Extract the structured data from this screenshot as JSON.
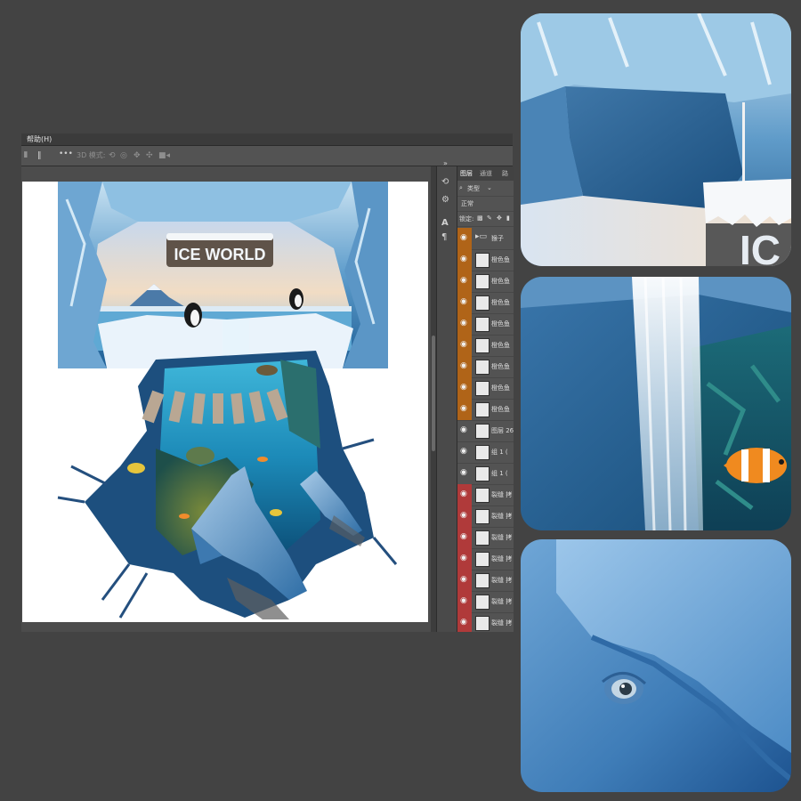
{
  "menubar": {
    "help_label": "帮助(H)"
  },
  "options_bar": {
    "mode_label": "3D 模式:",
    "more_label": "•••"
  },
  "layers_panel": {
    "tabs": [
      "图层",
      "通道",
      "路"
    ],
    "filter_label": "类型",
    "blend_mode": "正常",
    "lock_label": "锁定:",
    "layers": [
      {
        "name": "猴子",
        "color": "orange",
        "visible": true,
        "folder": true
      },
      {
        "name": "橙色鱼",
        "color": "orange",
        "visible": true
      },
      {
        "name": "橙色鱼",
        "color": "orange",
        "visible": true
      },
      {
        "name": "橙色鱼",
        "color": "orange",
        "visible": true
      },
      {
        "name": "橙色鱼",
        "color": "orange",
        "visible": true
      },
      {
        "name": "橙色鱼",
        "color": "orange",
        "visible": true
      },
      {
        "name": "橙色鱼",
        "color": "orange",
        "visible": true
      },
      {
        "name": "橙色鱼",
        "color": "orange",
        "visible": true
      },
      {
        "name": "橙色鱼",
        "color": "orange",
        "visible": true
      },
      {
        "name": "图层 26",
        "color": "none",
        "visible": true
      },
      {
        "name": "组 1 (",
        "color": "none",
        "visible": true
      },
      {
        "name": "组 1 (",
        "color": "none",
        "visible": true
      },
      {
        "name": "裂缝 拷",
        "color": "red",
        "visible": true
      },
      {
        "name": "裂缝 拷",
        "color": "red",
        "visible": true
      },
      {
        "name": "裂缝 拷",
        "color": "red",
        "visible": true
      },
      {
        "name": "裂缝 拷",
        "color": "red",
        "visible": true
      },
      {
        "name": "裂缝 拷",
        "color": "red",
        "visible": true
      },
      {
        "name": "裂缝 拷",
        "color": "red",
        "visible": true
      },
      {
        "name": "裂缝 拷",
        "color": "red",
        "visible": true
      }
    ]
  },
  "artwork": {
    "sign_text": "ICE WORLD"
  },
  "cards": {
    "card1_sign_fragment": "IC"
  },
  "colors": {
    "layer_orange": "#b06418",
    "layer_red": "#b03a3a",
    "ice_blue": "#2c6ea8"
  }
}
